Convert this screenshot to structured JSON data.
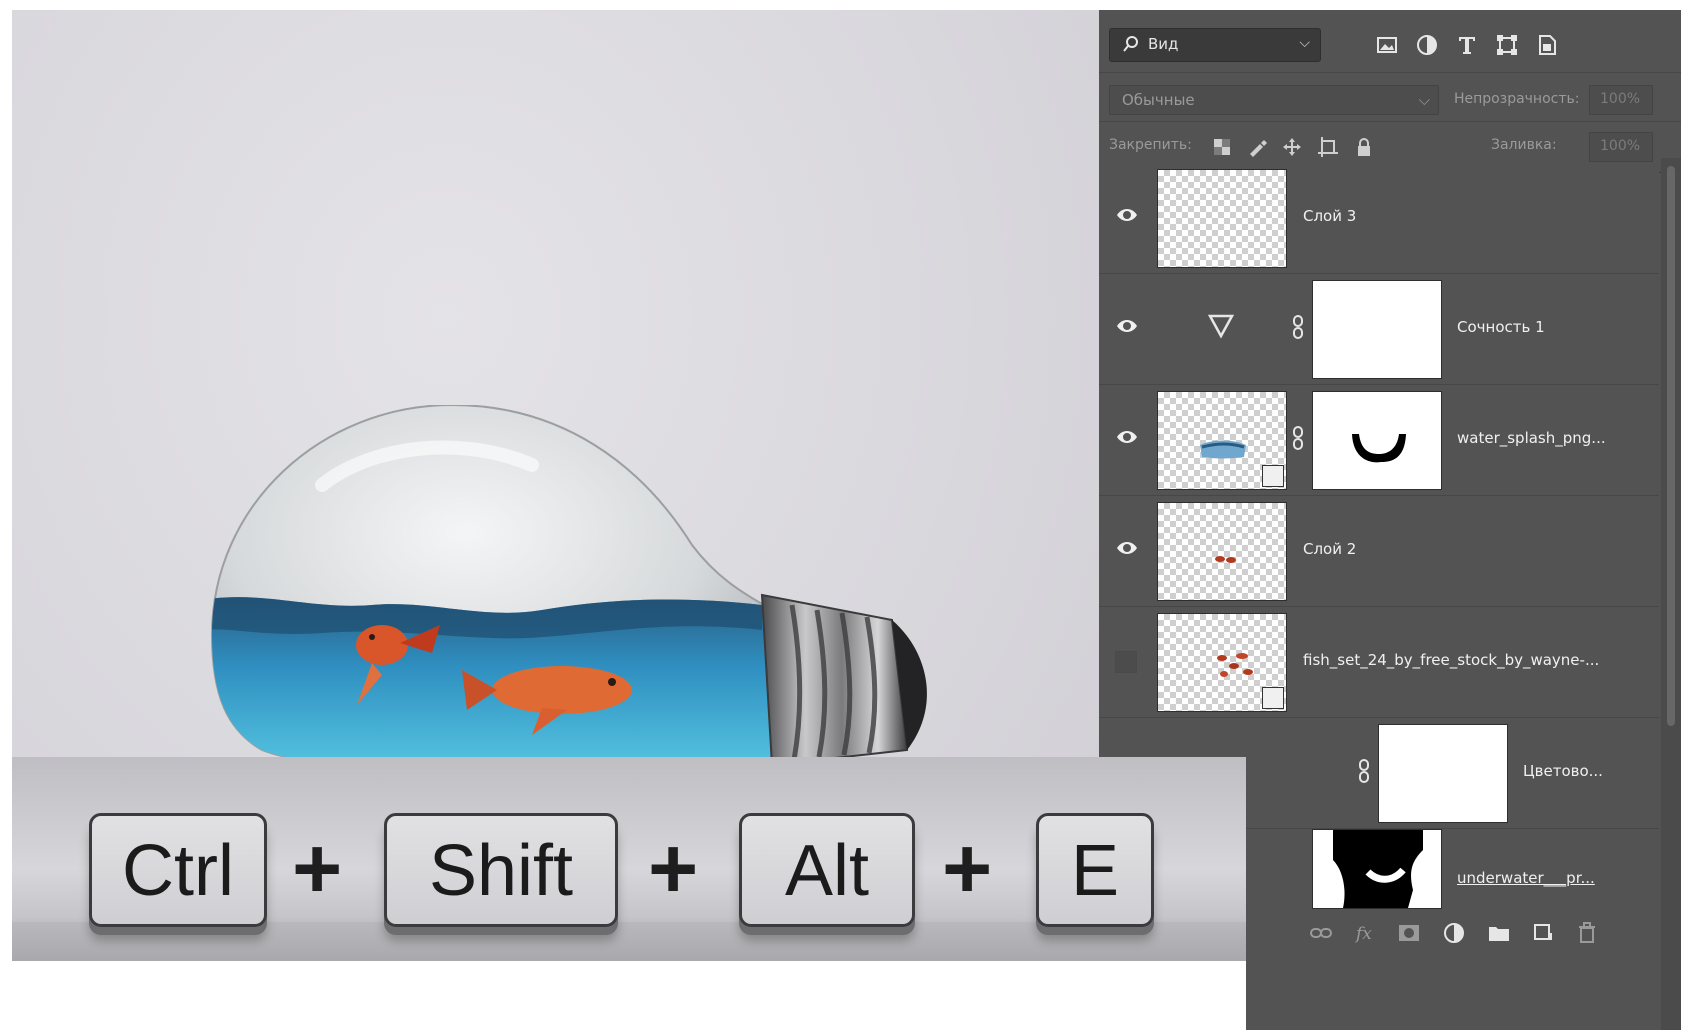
{
  "canvas": {
    "description_label": ""
  },
  "layers_panel": {
    "filter": {
      "label": "Вид",
      "icons": [
        "image-filter-icon",
        "adjustment-filter-icon",
        "type-filter-icon",
        "shape-filter-icon",
        "smart-object-filter-icon"
      ]
    },
    "blend_mode": "Обычные",
    "opacity_label": "Непрозрачность:",
    "opacity_value": "100%",
    "lock_label": "Закрепить:",
    "fill_label": "Заливка:",
    "fill_value": "100%",
    "layers": [
      {
        "name": "Слой 3",
        "visible": true
      },
      {
        "name": "Сочность 1",
        "visible": true
      },
      {
        "name": "water_splash_png...",
        "visible": true
      },
      {
        "name": "Слой 2",
        "visible": true
      },
      {
        "name": "fish_set_24_by_free_stock_by_wayne-...",
        "visible": false
      },
      {
        "name": "Цветово...",
        "visible": false
      },
      {
        "name": "underwater___pr...",
        "visible": false
      }
    ],
    "bottom_icons": [
      "link-layers-icon",
      "fx-icon",
      "add-mask-icon",
      "adjustment-layer-icon",
      "new-group-icon",
      "new-layer-icon",
      "delete-icon"
    ]
  },
  "shortcut": {
    "keys": [
      "Ctrl",
      "Shift",
      "Alt",
      "E"
    ],
    "separator": "+"
  }
}
